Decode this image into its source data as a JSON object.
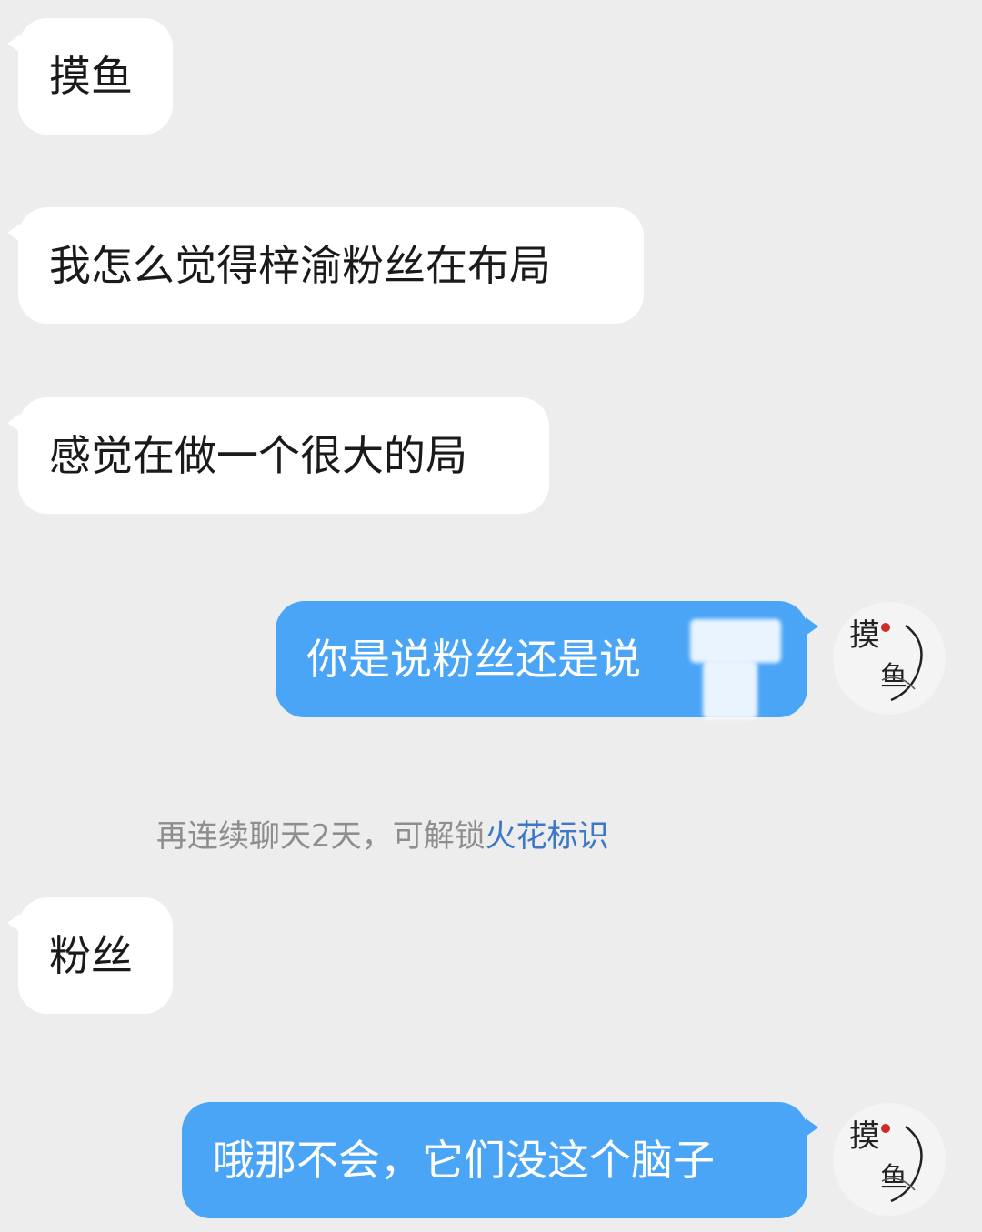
{
  "chat": {
    "messages": [
      {
        "side": "left",
        "text": "摸鱼"
      },
      {
        "side": "left",
        "text": "我怎么觉得梓渝粉丝在布局"
      },
      {
        "side": "left",
        "text": "感觉在做一个很大的局"
      },
      {
        "side": "right",
        "text": "你是说粉丝还是说"
      },
      {
        "side": "left",
        "text": "粉丝"
      },
      {
        "side": "right",
        "text": "哦那不会，它们没这个脑子"
      }
    ],
    "system_notice": {
      "prefix": "再连续聊天2天，可解锁",
      "link": "火花标识"
    },
    "avatar_label": "摸鱼"
  },
  "colors": {
    "background": "#ededed",
    "incoming_bubble": "#ffffff",
    "outgoing_bubble": "#4ba5f7",
    "system_text": "#8e8e8e",
    "system_link": "#3d78c8"
  }
}
